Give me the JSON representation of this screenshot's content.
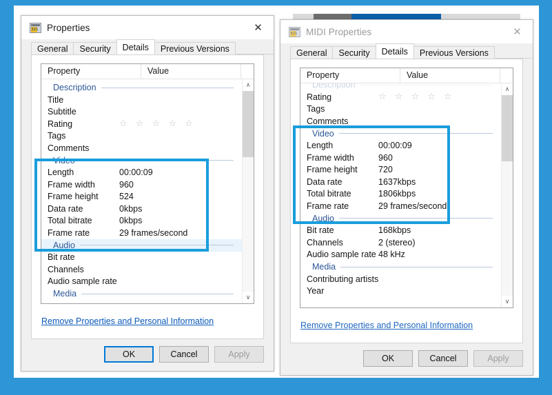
{
  "theme": {
    "background_color": "#2e96d6",
    "accent_highlight_color": "#1a9ddc",
    "group_header_color": "#2b5797",
    "link_color": "#0a59b9"
  },
  "dialogs": [
    {
      "id": "left",
      "title": "Properties",
      "icon": "video-file-icon",
      "active": true,
      "close_label": "✕",
      "tabs": [
        {
          "label": "General",
          "active": false
        },
        {
          "label": "Security",
          "active": false
        },
        {
          "label": "Details",
          "active": true
        },
        {
          "label": "Previous Versions",
          "active": false
        }
      ],
      "columns": {
        "property": "Property",
        "value": "Value"
      },
      "groups": [
        {
          "name": "Description",
          "selected": false,
          "rows": [
            {
              "name": "Title",
              "value": ""
            },
            {
              "name": "Subtitle",
              "value": ""
            },
            {
              "name": "Rating",
              "value": "☆ ☆ ☆ ☆ ☆",
              "is_stars": true
            },
            {
              "name": "Tags",
              "value": ""
            },
            {
              "name": "Comments",
              "value": ""
            }
          ]
        },
        {
          "name": "Video",
          "selected": false,
          "rows": [
            {
              "name": "Length",
              "value": "00:00:09"
            },
            {
              "name": "Frame width",
              "value": "960"
            },
            {
              "name": "Frame height",
              "value": "524"
            },
            {
              "name": "Data rate",
              "value": "0kbps"
            },
            {
              "name": "Total bitrate",
              "value": "0kbps"
            },
            {
              "name": "Frame rate",
              "value": "29 frames/second"
            }
          ]
        },
        {
          "name": "Audio",
          "selected": true,
          "rows": [
            {
              "name": "Bit rate",
              "value": ""
            },
            {
              "name": "Channels",
              "value": ""
            },
            {
              "name": "Audio sample rate",
              "value": ""
            }
          ]
        },
        {
          "name": "Media",
          "selected": false,
          "rows": []
        }
      ],
      "remove_link": "Remove Properties and Personal Information",
      "buttons": [
        {
          "label": "OK",
          "state": "default"
        },
        {
          "label": "Cancel",
          "state": "normal"
        },
        {
          "label": "Apply",
          "state": "disabled"
        }
      ],
      "scrollbar": {
        "up_arrow": "∧",
        "down_arrow": "∨",
        "thumb_top_pct": 0,
        "thumb_height_pct": 33
      }
    },
    {
      "id": "right",
      "title": "MIDI Properties",
      "icon": "video-file-icon",
      "active": false,
      "close_label": "✕",
      "tabs": [
        {
          "label": "General",
          "active": false
        },
        {
          "label": "Security",
          "active": false
        },
        {
          "label": "Details",
          "active": true
        },
        {
          "label": "Previous Versions",
          "active": false
        }
      ],
      "columns": {
        "property": "Property",
        "value": "Value"
      },
      "groups": [
        {
          "name": "Description",
          "selected": false,
          "partial_top": true,
          "rows": [
            {
              "name": "Rating",
              "value": "☆ ☆ ☆ ☆ ☆",
              "is_stars": true
            },
            {
              "name": "Tags",
              "value": ""
            },
            {
              "name": "Comments",
              "value": ""
            }
          ]
        },
        {
          "name": "Video",
          "selected": false,
          "rows": [
            {
              "name": "Length",
              "value": "00:00:09"
            },
            {
              "name": "Frame width",
              "value": "960"
            },
            {
              "name": "Frame height",
              "value": "720"
            },
            {
              "name": "Data rate",
              "value": "1637kbps"
            },
            {
              "name": "Total bitrate",
              "value": "1806kbps"
            },
            {
              "name": "Frame rate",
              "value": "29 frames/second"
            }
          ]
        },
        {
          "name": "Audio",
          "selected": false,
          "rows": [
            {
              "name": "Bit rate",
              "value": "168kbps"
            },
            {
              "name": "Channels",
              "value": "2 (stereo)"
            },
            {
              "name": "Audio sample rate",
              "value": "48 kHz"
            }
          ]
        },
        {
          "name": "Media",
          "selected": false,
          "rows": [
            {
              "name": "Contributing artists",
              "value": ""
            },
            {
              "name": "Year",
              "value": ""
            }
          ]
        }
      ],
      "remove_link": "Remove Properties and Personal Information",
      "buttons": [
        {
          "label": "OK",
          "state": "normal"
        },
        {
          "label": "Cancel",
          "state": "normal"
        },
        {
          "label": "Apply",
          "state": "disabled"
        }
      ],
      "scrollbar": {
        "up_arrow": "∧",
        "down_arrow": "∨",
        "thumb_top_pct": 0,
        "thumb_height_pct": 33
      }
    }
  ],
  "annotations": [
    {
      "target": "left-video-section",
      "shape": "rectangle",
      "color": "#1a9ddc"
    },
    {
      "target": "right-video-section",
      "shape": "rectangle",
      "color": "#1a9ddc"
    }
  ]
}
